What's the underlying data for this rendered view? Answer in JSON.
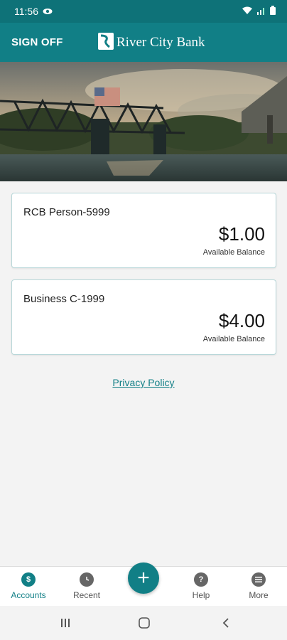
{
  "status_bar": {
    "time": "11:56"
  },
  "header": {
    "sign_off_label": "SIGN OFF",
    "brand_name": "River City Bank"
  },
  "accounts": [
    {
      "name": "RCB Person-5999",
      "balance": "$1.00",
      "caption": "Available Balance"
    },
    {
      "name": "Business C-1999",
      "balance": "$4.00",
      "caption": "Available Balance"
    }
  ],
  "privacy_link": "Privacy Policy",
  "bottom_nav": {
    "items": [
      {
        "label": "Accounts",
        "icon": "accounts-icon"
      },
      {
        "label": "Recent",
        "icon": "clock-icon"
      },
      {
        "label": "",
        "icon": "plus-icon"
      },
      {
        "label": "Help",
        "icon": "help-icon"
      },
      {
        "label": "More",
        "icon": "more-icon"
      }
    ]
  },
  "colors": {
    "primary": "#117f86",
    "status_bar": "#0e7278",
    "active_nav": "#117f86"
  }
}
